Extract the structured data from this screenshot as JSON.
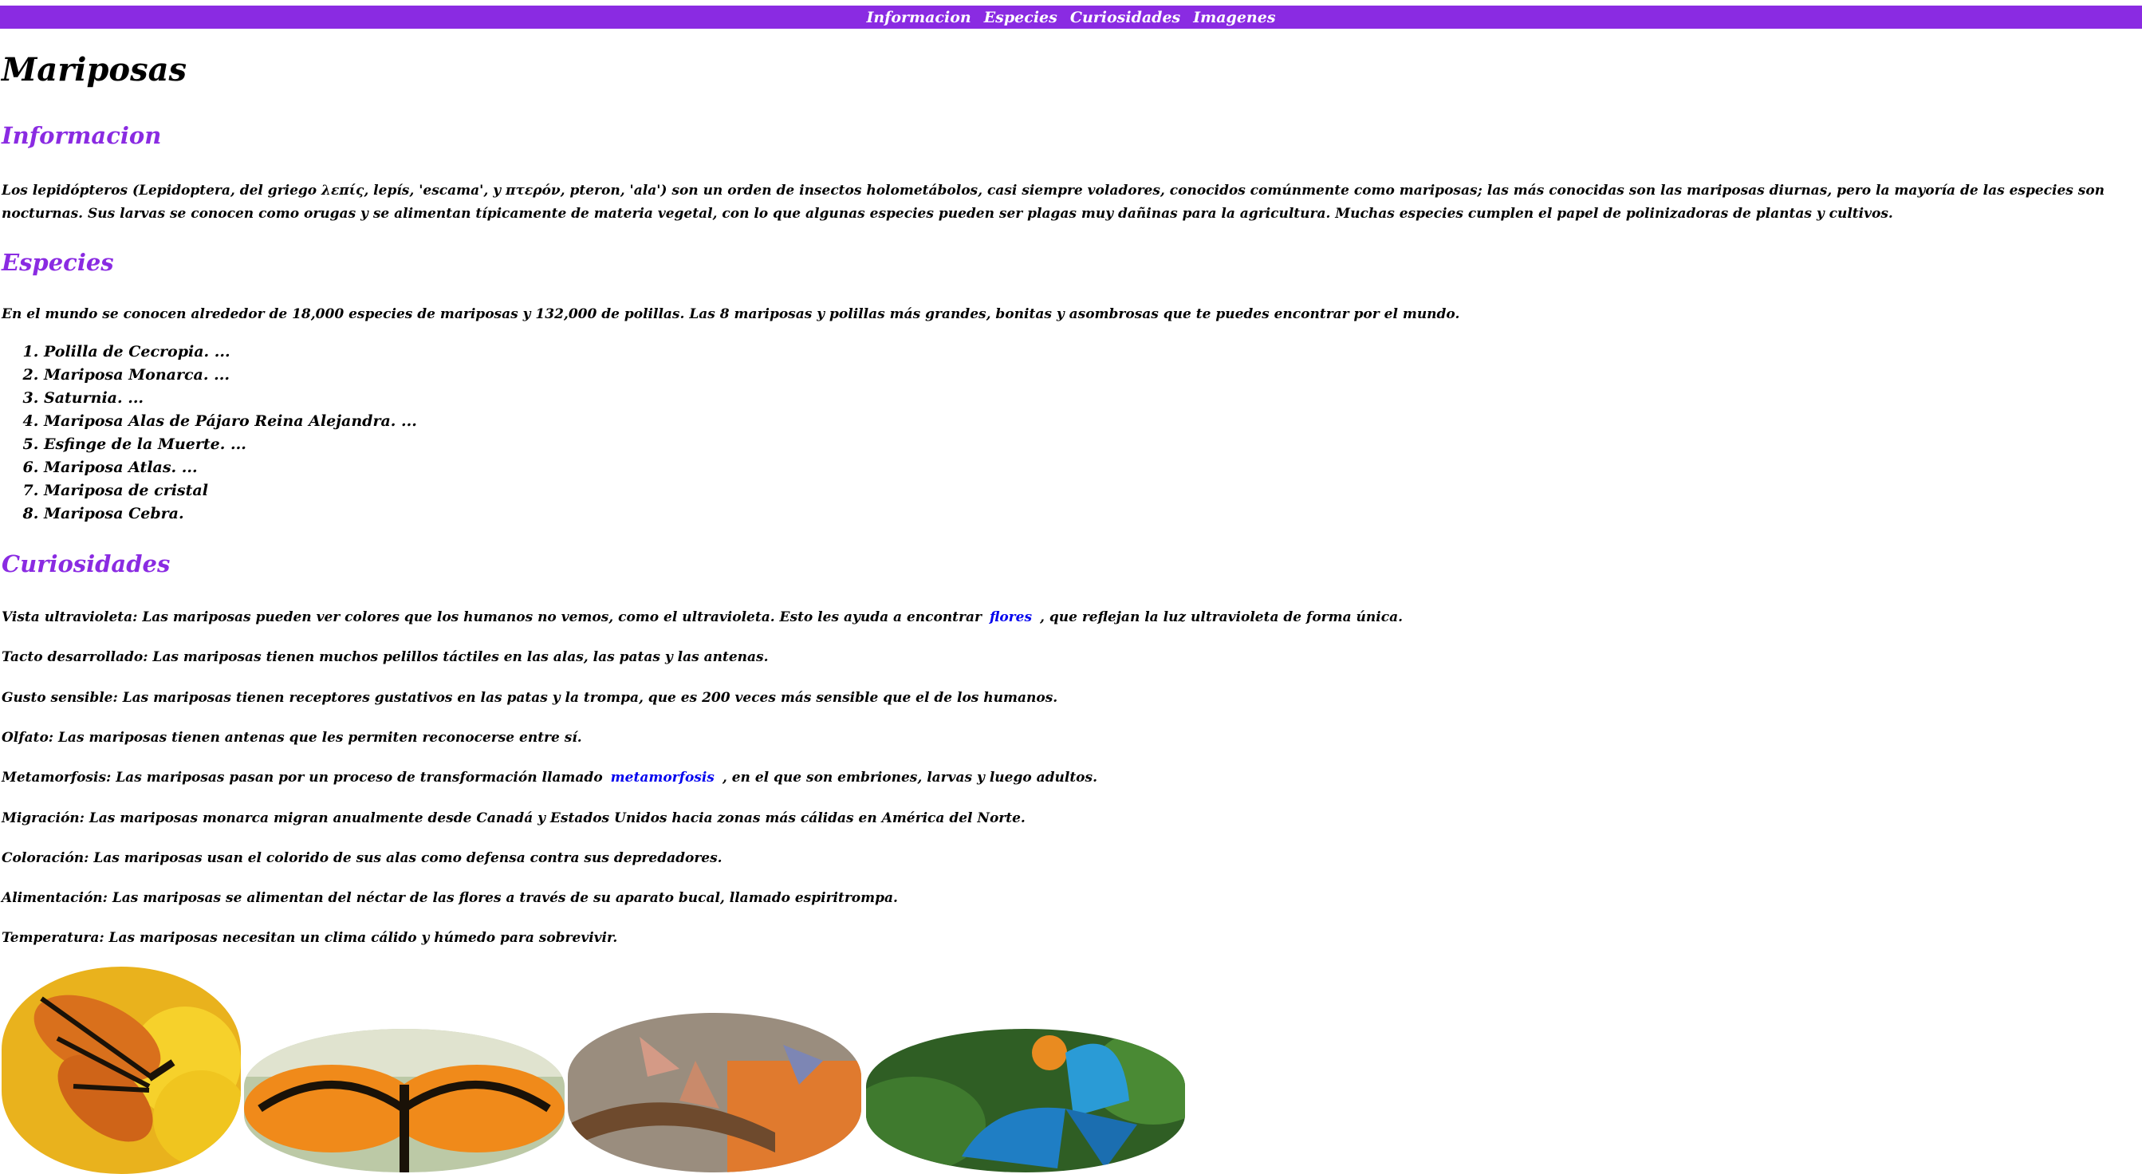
{
  "nav": {
    "items": [
      "Informacion",
      "Especies",
      "Curiosidades",
      "Imagenes"
    ]
  },
  "page": {
    "title": "Mariposas"
  },
  "informacion": {
    "heading": "Informacion",
    "text": "Los lepidópteros (Lepidoptera, del griego λεπίς, lepís, 'escama', y πτερόν, pteron, 'ala') son un orden de insectos holometábolos, casi siempre voladores, conocidos comúnmente como mariposas; las más conocidas son las mariposas diurnas, pero la mayoría de las especies son nocturnas. Sus larvas se conocen como orugas y se alimentan típicamente de materia vegetal, con lo que algunas especies pueden ser plagas muy dañinas para la agricultura. Muchas especies cumplen el papel de polinizadoras de plantas y cultivos."
  },
  "especies": {
    "heading": "Especies",
    "intro": "En el mundo se conocen alrededor de 18,000 especies de mariposas y 132,000 de polillas. Las 8 mariposas y polillas más grandes, bonitas y asombrosas que te puedes encontrar por el mundo.",
    "list": [
      "Polilla de Cecropia. ...",
      "Mariposa Monarca. ...",
      "Saturnia. ...",
      "Mariposa Alas de Pájaro Reina Alejandra. ...",
      "Esfinge de la Muerte. ...",
      "Mariposa Atlas. ...",
      "Mariposa de cristal",
      "Mariposa Cebra."
    ]
  },
  "curiosidades": {
    "heading": "Curiosidades",
    "vista": {
      "before": "Vista ultravioleta: Las mariposas pueden ver colores que los humanos no vemos, como el ultravioleta. Esto les ayuda a encontrar",
      "link": "flores",
      "after": ", que reflejan la luz ultravioleta de forma única."
    },
    "tacto": "Tacto desarrollado: Las mariposas tienen muchos pelillos táctiles en las alas, las patas y las antenas.",
    "gusto": "Gusto sensible: Las mariposas tienen receptores gustativos en las patas y la trompa, que es 200 veces más sensible que el de los humanos.",
    "olfato": "Olfato: Las mariposas tienen antenas que les permiten reconocerse entre sí.",
    "metamorfosis": {
      "before": "Metamorfosis: Las mariposas pasan por un proceso de transformación llamado",
      "link": "metamorfosis",
      "after": ", en el que son embriones, larvas y luego adultos."
    },
    "migracion": "Migración: Las mariposas monarca migran anualmente desde Canadá y Estados Unidos hacia zonas más cálidas en América del Norte.",
    "coloracion": "Coloración: Las mariposas usan el colorido de sus alas como defensa contra sus depredadores.",
    "alimentacion": "Alimentación: Las mariposas se alimentan del néctar de las flores a través de su aparato bucal, llamado espiritrompa.",
    "temperatura": "Temperatura: Las mariposas necesitan un clima cálido y húmedo para sobrevivir."
  },
  "colors": {
    "accent": "#8a2be2",
    "link": "#0000ee",
    "nav_text": "#ffffff"
  }
}
